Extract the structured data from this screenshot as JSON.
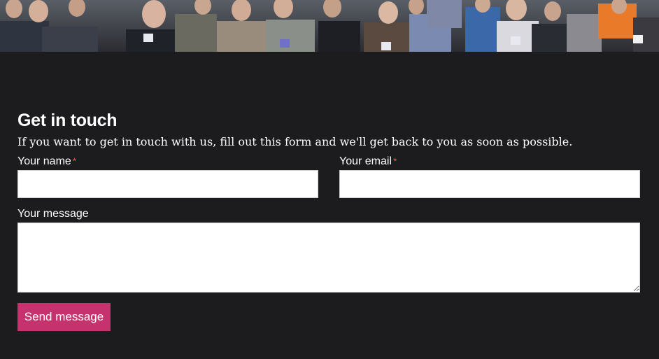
{
  "hero": {
    "image_description_icon": "crowd-photo-icon"
  },
  "contact": {
    "title": "Get in touch",
    "subtitle": "If you want to get in touch with us, fill out this form and we'll get back to you as soon as possible.",
    "name_label": "Your name",
    "email_label": "Your email",
    "required_marker": "*",
    "message_label": "Your message",
    "name_value": "",
    "email_value": "",
    "message_value": "",
    "send_label": "Send message"
  },
  "colors": {
    "background": "#1c1c1e",
    "accent": "#c5326d",
    "required": "#d9574d",
    "text": "#ffffff"
  }
}
